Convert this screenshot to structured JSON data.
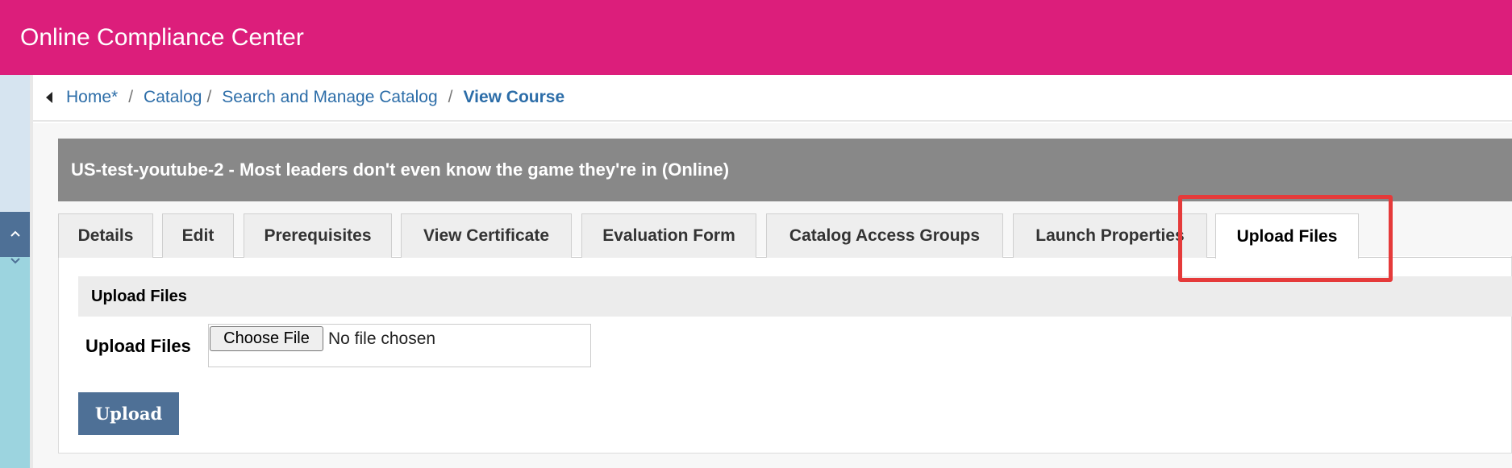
{
  "app": {
    "title": "Online Compliance Center"
  },
  "sidebar": {
    "buttons": [
      {
        "icon": "chevron-down-icon",
        "active": false
      },
      {
        "icon": "chevron-down-icon",
        "active": false
      },
      {
        "icon": "chevron-up-icon",
        "active": true
      }
    ]
  },
  "breadcrumb": {
    "items": [
      "Home*",
      "Catalog",
      "Search and Manage Catalog"
    ],
    "separators": [
      "/",
      "/",
      "/"
    ],
    "current": "View Course"
  },
  "course": {
    "title": "US-test-youtube-2 - Most leaders don't even know the game they're in (Online)"
  },
  "tabs": [
    {
      "label": "Details"
    },
    {
      "label": "Edit"
    },
    {
      "label": "Prerequisites"
    },
    {
      "label": "View Certificate"
    },
    {
      "label": "Evaluation Form"
    },
    {
      "label": "Catalog Access Groups"
    },
    {
      "label": "Launch Properties"
    },
    {
      "label": "Upload Files",
      "active": true
    }
  ],
  "upload": {
    "section_title": "Upload Files",
    "field_label": "Upload Files",
    "choose_label": "Choose File",
    "no_file_text": "No file chosen",
    "submit_label": "Upload"
  },
  "colors": {
    "brand": "#dc1e7b",
    "accent": "#4e7096",
    "link": "#2c6da8",
    "header_gray": "#888888",
    "highlight": "#e53a3a"
  }
}
